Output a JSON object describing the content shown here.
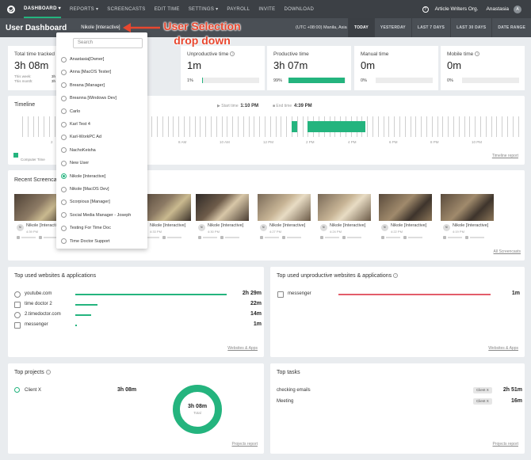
{
  "nav": {
    "items": [
      "DASHBOARD",
      "REPORTS",
      "SCREENCASTS",
      "EDIT TIME",
      "SETTINGS",
      "PAYROLL",
      "INVITE",
      "DOWNLOAD"
    ],
    "org": "Article Writers Org.",
    "user": "Anastasia",
    "avatar": "A"
  },
  "subnav": {
    "title": "User Dashboard",
    "selected_user": "Nikole [Interactive]",
    "timezone": "(UTC +08:00) Manila, Asia",
    "ranges": [
      "TODAY",
      "YESTERDAY",
      "LAST 7 DAYS",
      "LAST 30 DAYS",
      "DATE RANGE"
    ]
  },
  "annotation": {
    "text": "User Selection drop down"
  },
  "metrics": {
    "total": {
      "title": "Total time tracked",
      "value": "3h 08m",
      "week_label": "This week:",
      "week_value": "3h 08m",
      "month_label": "This month:",
      "month_value": "3h 08m"
    },
    "unproductive": {
      "title": "Unproductive time",
      "value": "1m",
      "pct": "1%",
      "fill": 0.01
    },
    "productive": {
      "title": "Productive time",
      "value": "3h 07m",
      "pct": "99%",
      "fill": 0.99
    },
    "manual": {
      "title": "Manual time",
      "value": "0m",
      "pct": "0%",
      "fill": 0
    },
    "mobile": {
      "title": "Mobile time",
      "value": "0m",
      "pct": "0%",
      "fill": 0
    }
  },
  "timeline": {
    "title": "Timeline",
    "start_label": "Start time",
    "start_value": "1:10 PM",
    "end_label": "End time",
    "end_value": "4:39 PM",
    "axis_labels": [
      "2",
      "8 AM",
      "10 AM",
      "12 PM",
      "2 PM",
      "4 PM",
      "6 PM",
      "8 PM",
      "10 PM"
    ],
    "legend": "Computer Time",
    "link": "Timeline report"
  },
  "screencasts": {
    "title": "Recent Screencasts",
    "items": [
      {
        "name": "Nikole [Interactive]",
        "time": "4:39 PM",
        "avatar": "NI"
      },
      {
        "name": "Nikole [Interactive]",
        "time": "4:36 PM",
        "avatar": "NI"
      },
      {
        "name": "Nikole [Interactive]",
        "time": "4:33 PM",
        "avatar": "NI"
      },
      {
        "name": "Nikole [Interactive]",
        "time": "4:30 PM",
        "avatar": "NI"
      },
      {
        "name": "Nikole [Interactive]",
        "time": "4:27 PM",
        "avatar": "NI"
      },
      {
        "name": "Nikole [Interactive]",
        "time": "4:24 PM",
        "avatar": "NI"
      },
      {
        "name": "Nikole [Interactive]",
        "time": "4:22 PM",
        "avatar": "NI"
      },
      {
        "name": "Nikole [Interactive]",
        "time": "4:19 PM",
        "avatar": "NI"
      }
    ],
    "link": "All Screencasts"
  },
  "top_sites": {
    "title": "Top used websites & applications",
    "rows": [
      {
        "name": "youtube.com",
        "value": "2h 29m",
        "fill": 0.88,
        "icon": "globe-icon"
      },
      {
        "name": "time doctor 2",
        "value": "22m",
        "fill": 0.13,
        "icon": "app-icon"
      },
      {
        "name": "2.timedoctor.com",
        "value": "14m",
        "fill": 0.09,
        "icon": "globe-icon"
      },
      {
        "name": "messenger",
        "value": "1m",
        "fill": 0.01,
        "icon": "app-icon"
      }
    ],
    "link": "Websites & Apps"
  },
  "unproductive_sites": {
    "title": "Top used unproductive websites & applications",
    "rows": [
      {
        "name": "messenger",
        "value": "1m",
        "fill": 0.99,
        "icon": "app-icon"
      }
    ],
    "link": "Websites & Apps"
  },
  "projects": {
    "title": "Top projects",
    "rows": [
      {
        "name": "Client X",
        "value": "3h 08m"
      }
    ],
    "donut_value": "3h 08m",
    "donut_label": "Total",
    "link": "Projects report"
  },
  "tasks": {
    "title": "Top tasks",
    "rows": [
      {
        "name": "checking emails",
        "badge": "Client X",
        "value": "2h 51m"
      },
      {
        "name": "Meeting",
        "badge": "Client X",
        "value": "16m"
      }
    ],
    "link": "Projects report"
  },
  "dropdown": {
    "placeholder": "Search",
    "items": [
      "Anastasia[Owner]",
      "Anna [MacOS Tester]",
      "Breana [Manager]",
      "Breanna [Windows Dev]",
      "Carlo",
      "Karl Test 4",
      "Karl-WorkPC Ad",
      "NachoKeisha",
      "New User",
      "Nikole [Interactive]",
      "Nikole [MacOS Dev]",
      "Scorpious [Manager]",
      "Social Media Manager - Joseph",
      "Testing For Time Doc",
      "Time Doctor Support"
    ],
    "selected": "Nikole [Interactive]"
  },
  "colors": {
    "accent": "#24b47e",
    "annotation": "#e8472f",
    "nav": "#3c4045"
  }
}
